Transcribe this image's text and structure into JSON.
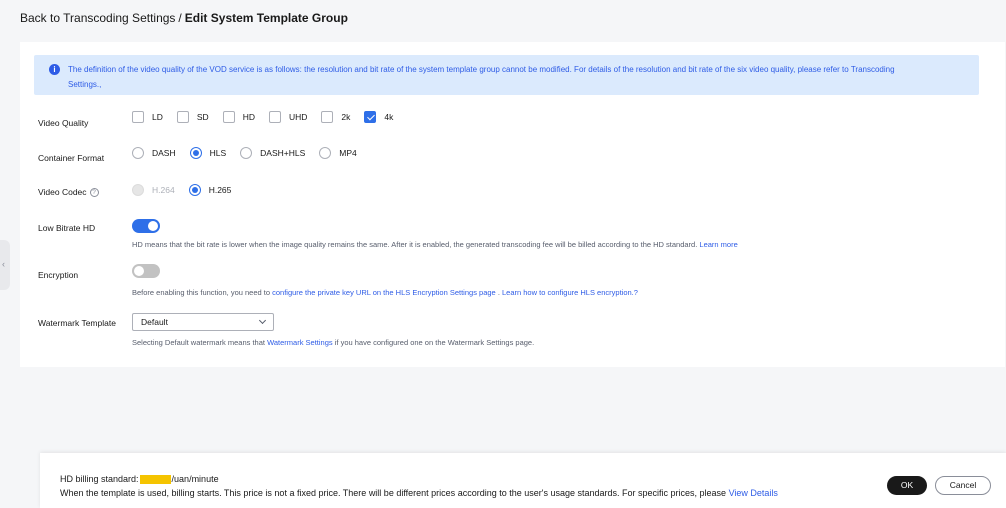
{
  "breadcrumb": {
    "back": "Back to Transcoding Settings",
    "separator": "/",
    "current": "Edit System Template Group"
  },
  "notice": {
    "line1": "The definition of the video quality of the VOD service is as follows: the resolution and bit rate of the system template group cannot be modified. For details of the resolution and bit rate of the six video quality, please refer to",
    "link": "Transcoding",
    "line2": "Settings.,"
  },
  "video_quality": {
    "label": "Video Quality",
    "options": [
      {
        "label": "LD",
        "checked": false
      },
      {
        "label": "SD",
        "checked": false
      },
      {
        "label": "HD",
        "checked": false
      },
      {
        "label": "UHD",
        "checked": false
      },
      {
        "label": "2k",
        "checked": false
      },
      {
        "label": "4k",
        "checked": true
      }
    ]
  },
  "container_format": {
    "label": "Container Format",
    "options": [
      {
        "label": "DASH",
        "checked": false
      },
      {
        "label": "HLS",
        "checked": true
      },
      {
        "label": "DASH+HLS",
        "checked": false
      },
      {
        "label": "MP4",
        "checked": false
      }
    ]
  },
  "video_codec": {
    "label": "Video Codec",
    "options": [
      {
        "label": "H.264",
        "checked": false,
        "disabled": true
      },
      {
        "label": "H.265",
        "checked": true,
        "disabled": false
      }
    ]
  },
  "low_bitrate": {
    "label": "Low Bitrate HD",
    "enabled": true,
    "desc": "HD means that the bit rate is lower when the image quality remains the same. After it is enabled, the generated transcoding fee will be billed according to the HD standard.",
    "link": "Learn more"
  },
  "encryption": {
    "label": "Encryption",
    "enabled": false,
    "desc_prefix": "Before enabling this function, you need to",
    "link1": "configure the private key URL on the HLS Encryption Settings page",
    "mid": ".",
    "link2": "Learn how to configure HLS encryption.",
    "suffix": "?"
  },
  "watermark": {
    "label": "Watermark Template",
    "value": "Default",
    "desc_prefix": "Selecting Default watermark means that",
    "link": "Watermark Settings",
    "desc_suffix": "if you have configured one on the Watermark Settings page."
  },
  "footer": {
    "billing_prefix": "HD billing standard:",
    "billing_suffix": "/uan/minute",
    "billing_note": "When the template is used, billing starts. This price is not a fixed price. There will be different prices according to the user's usage standards. For specific prices, please",
    "view_details": "View Details",
    "ok": "OK",
    "cancel": "Cancel"
  },
  "colors": {
    "accent": "#2e6fe8",
    "notice_bg": "#dbeafd",
    "redaction": "#f5c400"
  }
}
